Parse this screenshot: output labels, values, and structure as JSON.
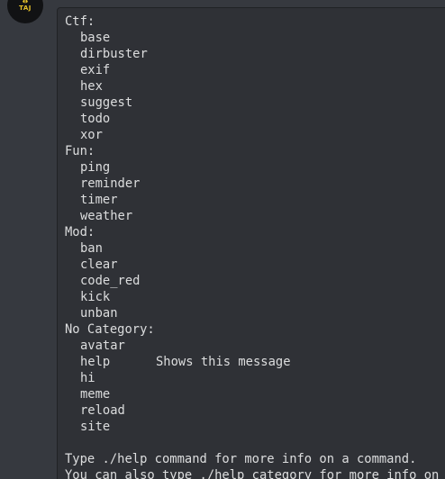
{
  "avatar": {
    "text": "TAJ",
    "icon": "logo-icon",
    "accent_color": "#e6c229"
  },
  "help": {
    "categories": [
      {
        "name": "Ctf:",
        "commands": [
          {
            "name": "base",
            "desc": ""
          },
          {
            "name": "dirbuster",
            "desc": ""
          },
          {
            "name": "exif",
            "desc": ""
          },
          {
            "name": "hex",
            "desc": ""
          },
          {
            "name": "suggest",
            "desc": ""
          },
          {
            "name": "todo",
            "desc": ""
          },
          {
            "name": "xor",
            "desc": ""
          }
        ]
      },
      {
        "name": "Fun:",
        "commands": [
          {
            "name": "ping",
            "desc": ""
          },
          {
            "name": "reminder",
            "desc": ""
          },
          {
            "name": "timer",
            "desc": ""
          },
          {
            "name": "weather",
            "desc": ""
          }
        ]
      },
      {
        "name": "Mod:",
        "commands": [
          {
            "name": "ban",
            "desc": ""
          },
          {
            "name": "clear",
            "desc": ""
          },
          {
            "name": "code_red",
            "desc": ""
          },
          {
            "name": "kick",
            "desc": ""
          },
          {
            "name": "unban",
            "desc": ""
          }
        ]
      },
      {
        "name": "No Category:",
        "commands": [
          {
            "name": "avatar",
            "desc": ""
          },
          {
            "name": "help",
            "desc": "Shows this message"
          },
          {
            "name": "hi",
            "desc": ""
          },
          {
            "name": "meme",
            "desc": ""
          },
          {
            "name": "reload",
            "desc": ""
          },
          {
            "name": "site",
            "desc": ""
          }
        ]
      }
    ],
    "footer": [
      "Type ./help command for more info on a command.",
      "You can also type ./help category for more info on a category."
    ]
  }
}
